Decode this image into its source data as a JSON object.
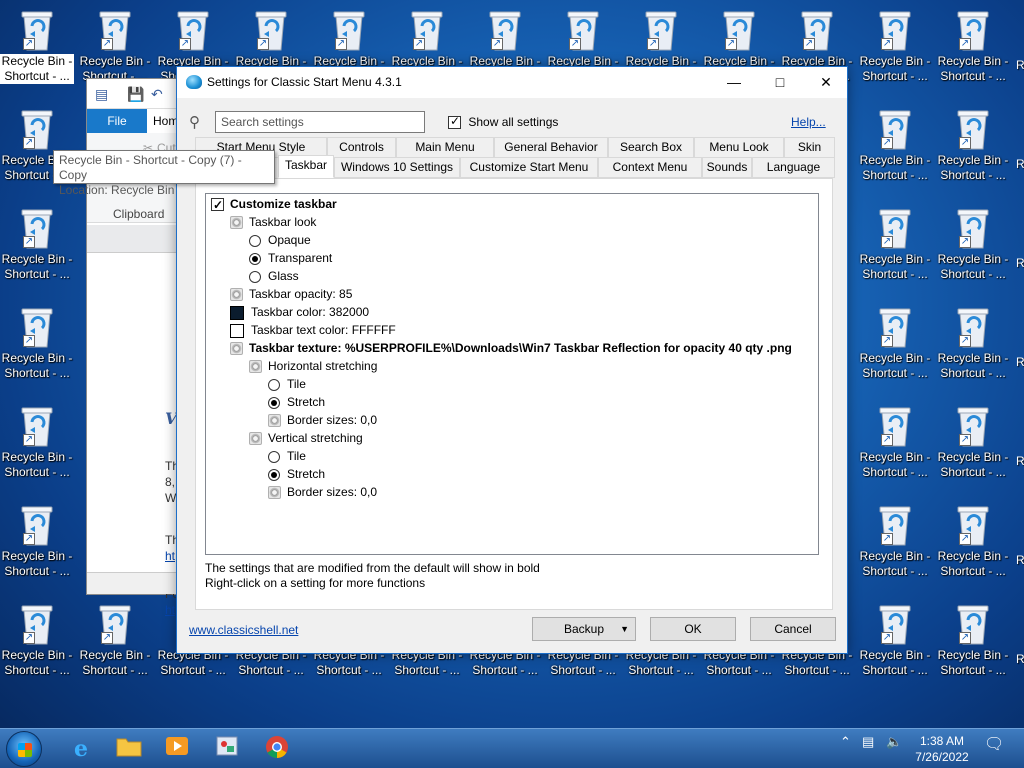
{
  "desktop": {
    "icon_label_line1": "Recycle Bin -",
    "icon_label_line2": "Shortcut - ...",
    "selected_label_line2": "Shortcut - ..."
  },
  "background_window": {
    "file_tab": "File",
    "home_tab": "Hom",
    "clipboard_group": "Clipboard",
    "cut_label": "Cut",
    "doc_letters": [
      "V",
      "Th",
      "8,",
      "W",
      "Th",
      "ht",
      "Fo",
      "ht"
    ]
  },
  "tooltip": {
    "line1": "Recycle Bin - Shortcut - Copy (7) - Copy",
    "line2": "Location: Recycle Bin"
  },
  "dialog": {
    "title": "Settings for Classic Start Menu 4.3.1",
    "search_placeholder": "Search settings",
    "show_all_label": "Show all settings",
    "help_link": "Help...",
    "tabs_row1": [
      "Start Menu Style",
      "Controls",
      "Main Menu",
      "General Behavior",
      "Search Box",
      "Menu Look",
      "Skin"
    ],
    "tabs_row2": [
      "Taskbar",
      "Windows 10 Settings",
      "Customize Start Menu",
      "Context Menu",
      "Sounds",
      "Language"
    ],
    "active_tab": "Taskbar",
    "tree": {
      "customize_taskbar": "Customize taskbar",
      "taskbar_look": "Taskbar look",
      "opaque": "Opaque",
      "transparent": "Transparent",
      "glass": "Glass",
      "taskbar_opacity": "Taskbar opacity: 85",
      "taskbar_color": "Taskbar color: 382000",
      "taskbar_text_color": "Taskbar text color: FFFFFF",
      "taskbar_texture": "Taskbar texture: %USERPROFILE%\\Downloads\\Win7 Taskbar Reflection for opacity 40 qty .png",
      "horizontal_stretching": "Horizontal stretching",
      "h_tile": "Tile",
      "h_stretch": "Stretch",
      "h_border": "Border sizes: 0,0",
      "vertical_stretching": "Vertical stretching",
      "v_tile": "Tile",
      "v_stretch": "Stretch",
      "v_border": "Border sizes: 0,0",
      "taskbar_color_hex": "#0b1c2e",
      "text_color_hex": "#ffffff"
    },
    "note_line1": "The settings that are modified from the default will show in bold",
    "note_line2": "Right-click on a setting for more functions",
    "website_link": "www.classicshell.net",
    "backup_button": "Backup",
    "ok_button": "OK",
    "cancel_button": "Cancel"
  },
  "taskbar": {
    "time": "1:38 AM",
    "date": "7/26/2022"
  }
}
